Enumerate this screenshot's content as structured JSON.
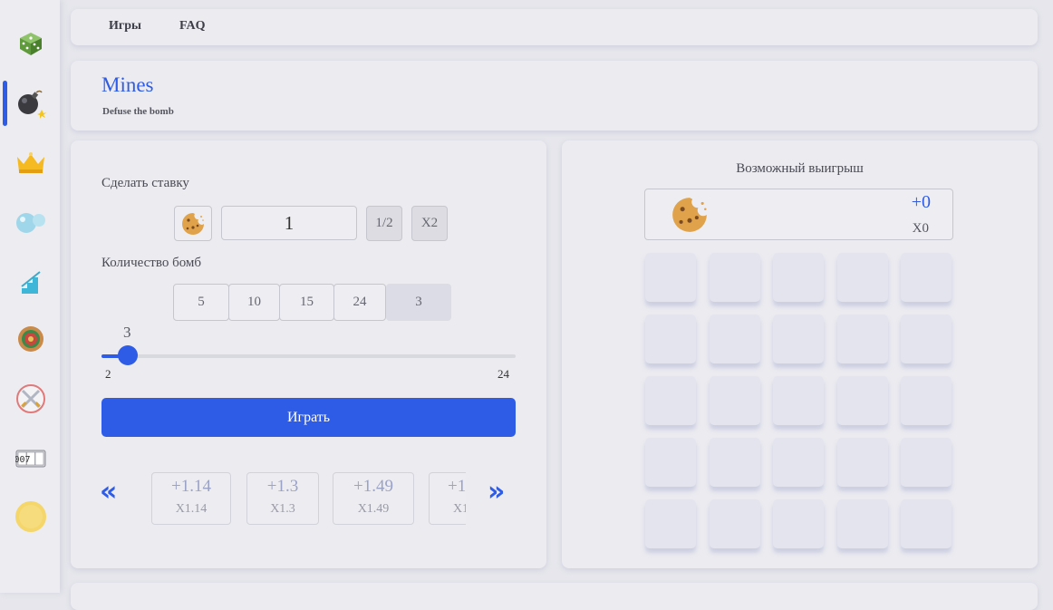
{
  "nav": {
    "games": "Игры",
    "faq": "FAQ"
  },
  "sidebar": {
    "items": [
      {
        "icon": "dice-icon"
      },
      {
        "icon": "bomb-icon",
        "active": true
      },
      {
        "icon": "crown-icon"
      },
      {
        "icon": "bubbles-icon"
      },
      {
        "icon": "stairs-icon"
      },
      {
        "icon": "roulette-icon"
      },
      {
        "icon": "crossed-swords-icon"
      },
      {
        "icon": "slot-counter-icon",
        "text": "007"
      },
      {
        "icon": "gold-coin-icon"
      }
    ]
  },
  "page": {
    "title": "Mines",
    "subtitle": "Defuse the bomb"
  },
  "bet": {
    "label": "Сделать ставку",
    "currency_icon": "cookie-icon",
    "value": "1",
    "half_label": "1/2",
    "double_label": "X2"
  },
  "bombs": {
    "label": "Количество бомб",
    "options": [
      "5",
      "10",
      "15",
      "24"
    ],
    "selected_display": "3",
    "slider": {
      "value": 3,
      "min": 2,
      "max": 24,
      "current_label": "3",
      "min_label": "2",
      "max_label": "24"
    }
  },
  "play_label": "Играть",
  "multipliers": {
    "prev_label": "«",
    "next_label": "»",
    "items": [
      {
        "plus": "+1.14",
        "x": "X1.14"
      },
      {
        "plus": "+1.3",
        "x": "X1.3"
      },
      {
        "plus": "+1.49",
        "x": "X1.49"
      },
      {
        "plus": "+1",
        "x": "X1"
      }
    ]
  },
  "win": {
    "title": "Возможный выигрыш",
    "icon": "cookie-icon",
    "amount": "+0",
    "multiplier": "X0"
  },
  "grid": {
    "rows": 5,
    "cols": 5
  },
  "colors": {
    "accent": "#2e5ce6",
    "background": "#e6e6ec",
    "panel": "#ebebf0"
  }
}
